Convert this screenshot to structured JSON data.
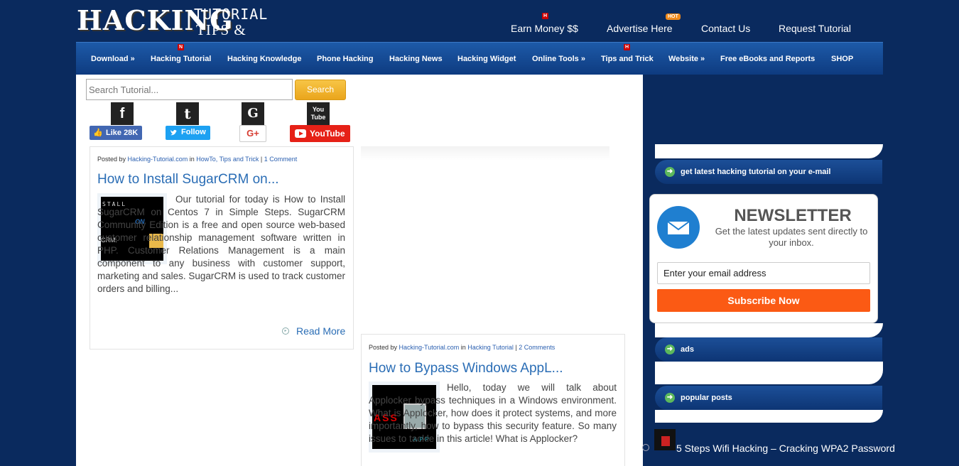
{
  "logo": {
    "main": "HACKING",
    "tutorial": "TUTORIAL",
    "tips": "TIPS & TRICK"
  },
  "topnav": {
    "earn_money": "Earn Money $$",
    "advertise": "Advertise Here",
    "contact": "Contact Us",
    "request": "Request Tutorial",
    "badge_h": "H",
    "badge_hot": "HOT"
  },
  "mainnav": {
    "items": [
      "Download »",
      "Hacking Tutorial",
      "Hacking Knowledge",
      "Phone Hacking",
      "Hacking News",
      "Hacking Widget",
      "Online Tools »",
      "Tips and Trick",
      "Website »",
      "Free eBooks and Reports",
      "SHOP"
    ],
    "badge_n": "N",
    "badge_h": "H"
  },
  "search": {
    "placeholder": "Search Tutorial...",
    "button": "Search"
  },
  "social": {
    "facebook_icon": "f",
    "twitter_icon": "t",
    "google_icon": "G",
    "youtube_icon": "You Tube",
    "facebook_btn": "Like 28K",
    "twitter_btn": "Follow",
    "google_btn": "G+",
    "youtube_btn": "YouTube"
  },
  "posts": [
    {
      "posted_by": "Posted by",
      "author": "Hacking-Tutorial.com",
      "in": "in",
      "categories": "HowTo, Tips and Trick",
      "sep": "|",
      "comments": "1 Comment",
      "title": "How to Install SugarCRM on...",
      "excerpt": "Our tutorial for today is How to Install SugarCRM on Centos 7 in Simple Steps. SugarCRM Community Edition is a free and open source web-based customer relationship management software written in PHP. Customer Relations Management is a main component to any business with customer support, marketing and sales. SugarCRM is used to track customer orders and billing...",
      "read_more": "Read More",
      "thumb_text1": "STALL",
      "thumb_text2": "ON",
      "thumb_text3": "CRM."
    },
    {
      "posted_by": "Posted by",
      "author": "Hacking-Tutorial.com",
      "in": "in",
      "categories": "Hacking Tutorial",
      "sep": "|",
      "comments": "2 Comments",
      "title": "How to Bypass Windows AppL...",
      "excerpt": "Hello, today we will talk about Applocker bypass techniques in a Windows environment. What is Applocker, how does it protect systems, and more importantly, how to bypass this security feature. So many issues to tackle in this article! What is Applocker?",
      "thumb_text1": "ASS",
      "thumb_text2": "APP"
    }
  ],
  "sidebar": {
    "email_head": "get latest hacking tutorial on your e-mail",
    "newsletter_title": "NEWSLETTER",
    "newsletter_sub": "Get the latest updates sent directly to your inbox.",
    "email_placeholder": "Enter your email address",
    "subscribe": "Subscribe Now",
    "ads_head": "ads",
    "popular_head": "popular posts",
    "popular_item": "5 Steps Wifi Hacking – Cracking WPA2 Password"
  },
  "colors": {
    "page_bg": "#0a2a5e",
    "nav_blue": "#1d5aa8",
    "link": "#2a6db5",
    "search_btn": "#f0b52e",
    "subscribe": "#fb5a14"
  }
}
